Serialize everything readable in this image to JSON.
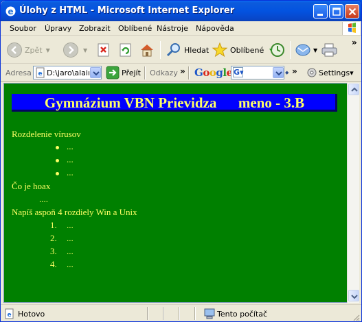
{
  "window": {
    "title": "Úlohy z HTML - Microsoft Internet Explorer"
  },
  "menu": [
    "Soubor",
    "Úpravy",
    "Zobrazit",
    "Oblíbené",
    "Nástroje",
    "Nápověda"
  ],
  "toolbar": {
    "back_label": "Zpět",
    "search_label": "Hledat",
    "favorites_label": "Oblíbené"
  },
  "address": {
    "label": "Adresa",
    "value": "D:\\jaro\\alair",
    "go_label": "Přejít",
    "links_label": "Odkazy",
    "google_logo": "Google",
    "google_search_value": "G▾",
    "settings_label": "Settings▾"
  },
  "page": {
    "banner": "Gymnázium VBN Prievidza      meno - 3.B",
    "section1": "Rozdelenie vírusov",
    "bullet_items": [
      "...",
      "...",
      "..."
    ],
    "section2": "Čo je hoax",
    "section2_text": "....",
    "section3": "Napíš aspoň 4 rozdiely Win a Unix",
    "ordered_items": [
      {
        "num": "1.",
        "text": "..."
      },
      {
        "num": "2.",
        "text": "..."
      },
      {
        "num": "3.",
        "text": "..."
      },
      {
        "num": "4.",
        "text": "..."
      }
    ]
  },
  "status": {
    "left": "Hotovo",
    "zone": "Tento počítač"
  },
  "colors": {
    "page_bg": "#008000",
    "banner_bg": "#0000ff",
    "page_text": "#ffff66"
  }
}
